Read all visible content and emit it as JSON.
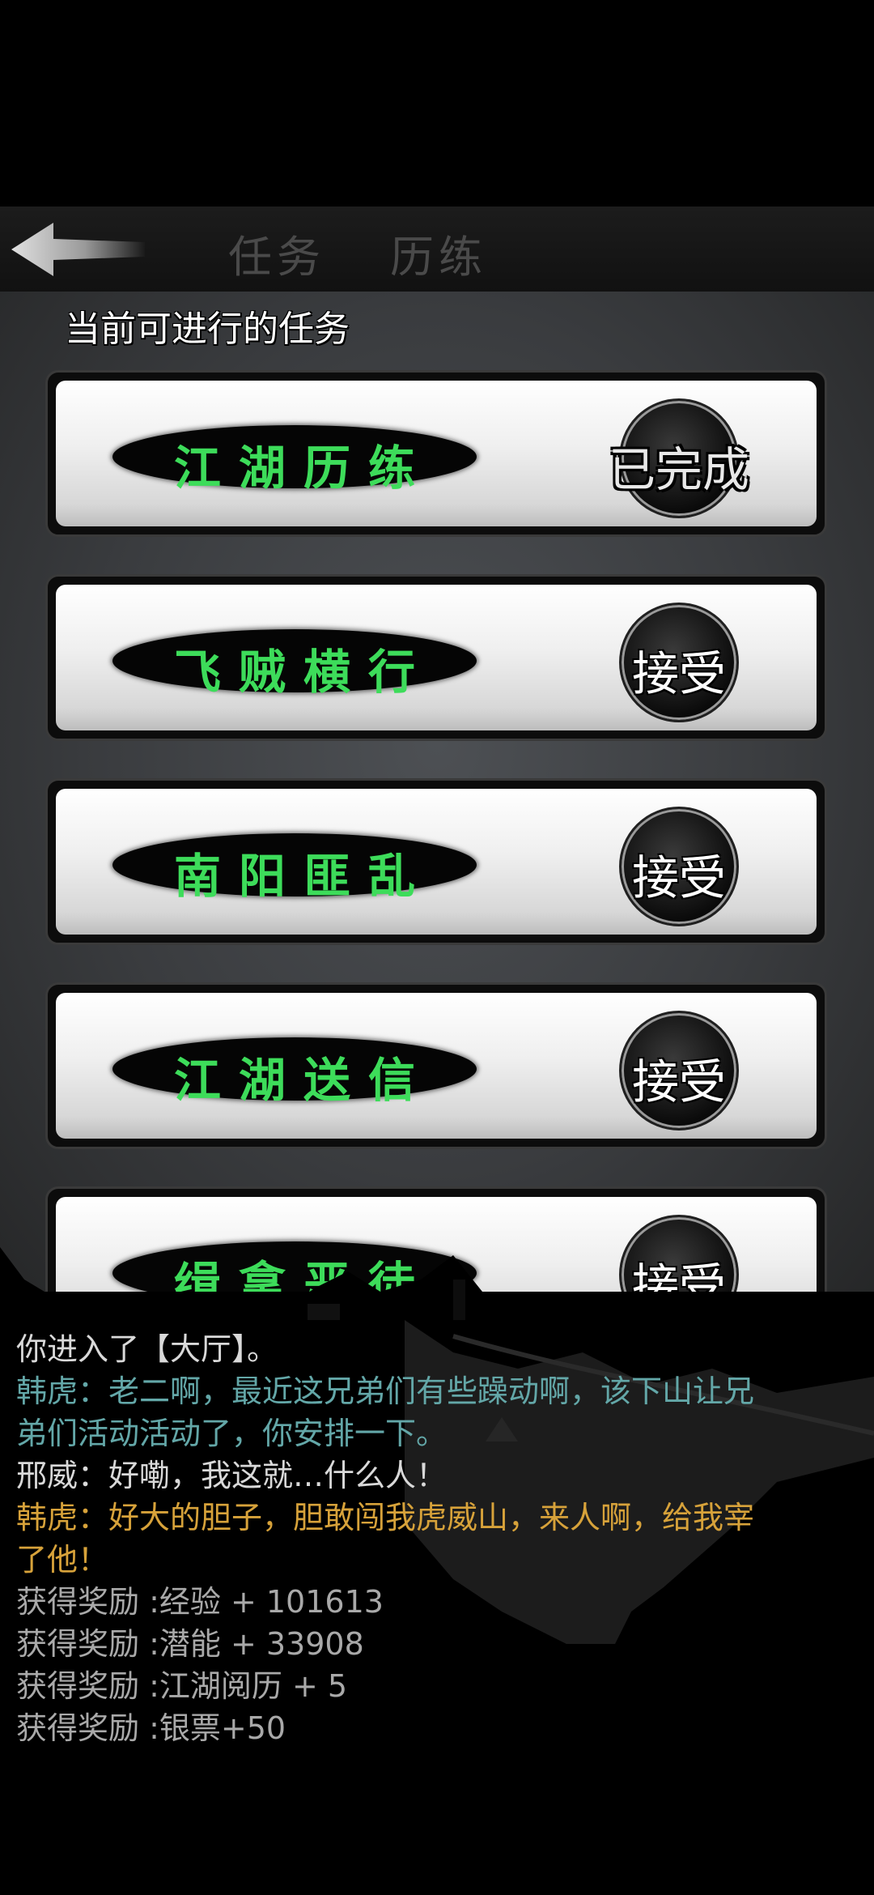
{
  "nav": {
    "tabs": [
      "任务",
      "历练"
    ]
  },
  "section_title": "当前可进行的任务",
  "quests": [
    {
      "name": "江湖历练",
      "action": "已完成"
    },
    {
      "name": "飞贼横行",
      "action": "接受"
    },
    {
      "name": "南阳匪乱",
      "action": "接受"
    },
    {
      "name": "江湖送信",
      "action": "接受"
    },
    {
      "name": "缉拿恶徒",
      "action": "接受"
    }
  ],
  "log": [
    {
      "text": "你进入了【大厅】。",
      "color": "#d9d9d9"
    },
    {
      "text": "韩虎：老二啊，最近这兄弟们有些躁动啊，该下山让兄",
      "color": "#63a7a8"
    },
    {
      "text": "弟们活动活动了，你安排一下。",
      "color": "#63a7a8"
    },
    {
      "text": "邢威：好嘞，我这就…什么人！",
      "color": "#d9d9d9"
    },
    {
      "text": "韩虎：好大的胆子，胆敢闯我虎威山，来人啊，给我宰",
      "color": "#d7a23a"
    },
    {
      "text": "了他！",
      "color": "#d7a23a"
    },
    {
      "text": "获得奖励 :经验 + 101613",
      "color": "#a9a9a9"
    },
    {
      "text": "获得奖励 :潜能 + 33908",
      "color": "#a9a9a9"
    },
    {
      "text": "获得奖励 :江湖阅历 + 5",
      "color": "#a9a9a9"
    },
    {
      "text": "获得奖励 :银票+50",
      "color": "#a9a9a9"
    }
  ],
  "colors": {
    "quest_name": "#3ddc5a",
    "dialog_teal": "#63a7a8",
    "dialog_gold": "#d7a23a"
  }
}
